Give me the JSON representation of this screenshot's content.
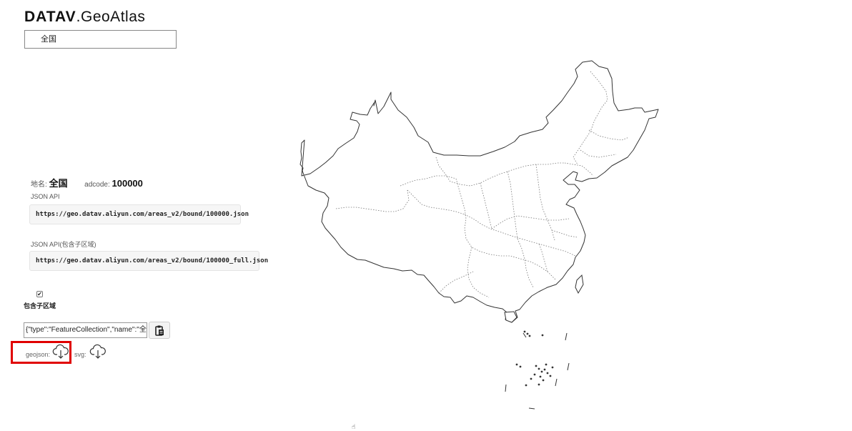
{
  "header": {
    "brand_bold": "DATAV",
    "brand_rest": ".GeoAtlas"
  },
  "region_select": {
    "value": "全国"
  },
  "info": {
    "name_label": "地名:",
    "name_value": "全国",
    "adcode_label": "adcode:",
    "adcode_value": "100000"
  },
  "json_api": {
    "label": "JSON API",
    "url": "https://geo.datav.aliyun.com/areas_v2/bound/100000.json"
  },
  "json_api_full": {
    "label": "JSON API(包含子区域)",
    "url": "https://geo.datav.aliyun.com/areas_v2/bound/100000_full.json"
  },
  "include_subregions": {
    "checked": true,
    "label": "包含子区域"
  },
  "geojson_text": {
    "value": "{\"type\":\"FeatureCollection\",\"name\":\"全"
  },
  "downloads": {
    "geojson_label": "geojson:",
    "svg_label": "svg:"
  },
  "icons": {
    "copy": "clipboard-icon",
    "download_geojson": "cloud-download-icon",
    "download_svg": "cloud-download-icon",
    "cursor": "hand-cursor-icon"
  },
  "colors": {
    "highlight": "#e00000",
    "map_stroke": "#333333"
  }
}
